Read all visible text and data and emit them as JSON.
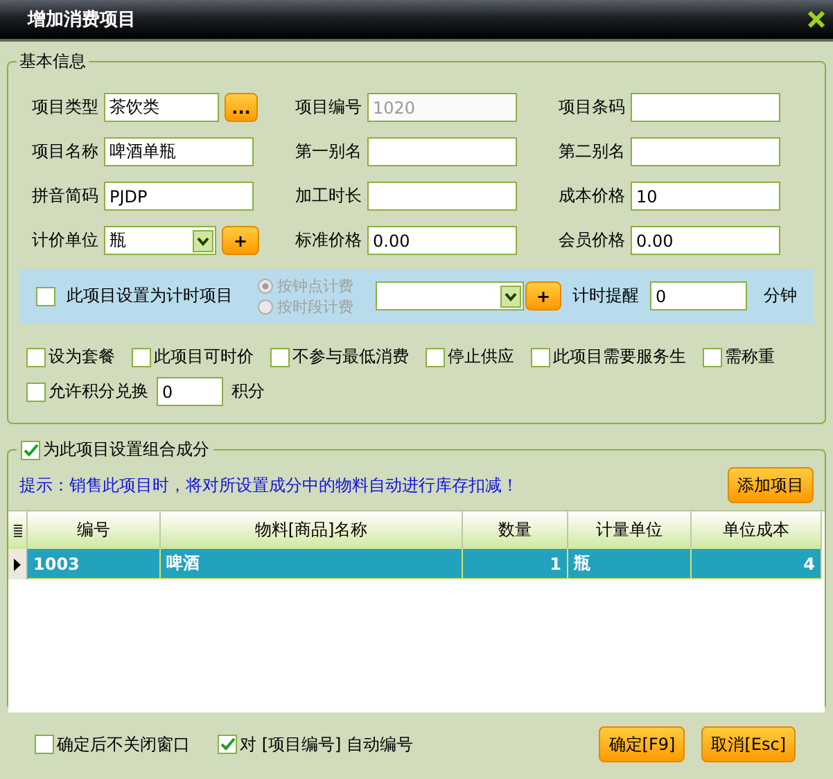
{
  "window": {
    "title": "增加消费项目"
  },
  "basic_info": {
    "title": "基本信息",
    "rows": [
      [
        {
          "label": "项目类型",
          "value": "茶饮类",
          "kind": "browse",
          "button": "...",
          "disabled": false
        },
        {
          "label": "项目编号",
          "value": "1020",
          "kind": "text",
          "disabled": true
        },
        {
          "label": "项目条码",
          "kind": "text"
        }
      ],
      [
        {
          "label": "项目名称",
          "value": "啤酒单瓶",
          "kind": "text",
          "disabled": false
        },
        {
          "label": "第一别名",
          "kind": "text"
        },
        {
          "label": "第二别名",
          "kind": "text"
        }
      ],
      [
        {
          "label": "拼音简码",
          "value": "PJDP",
          "kind": "text",
          "disabled": false
        },
        {
          "label": "加工时长",
          "kind": "text"
        },
        {
          "label": "成本价格",
          "value": "10",
          "kind": "text",
          "disabled": false
        }
      ],
      [
        {
          "label": "计价单位",
          "value": "瓶",
          "kind": "select",
          "button": "+",
          "disabled": false
        },
        {
          "label": "标准价格",
          "value": "0.00",
          "kind": "text",
          "disabled": false
        },
        {
          "label": "会员价格",
          "value": "0.00",
          "kind": "text",
          "disabled": false
        }
      ]
    ],
    "timing": {
      "checked": false,
      "label": "此项目设置为计时项目",
      "options": [
        {
          "label": "按钟点计费",
          "selected": true,
          "disabled": true
        },
        {
          "label": "按时段计费",
          "selected": false,
          "disabled": true
        }
      ],
      "add_button": "+",
      "reminder_label": "计时提醒",
      "reminder_value": "0",
      "unit": "分钟"
    },
    "options": [
      {
        "label": "设为套餐",
        "checked": false
      },
      {
        "label": "此项目可时价",
        "checked": false
      },
      {
        "label": "不参与最低消费",
        "checked": false
      },
      {
        "label": "停止供应",
        "checked": false
      },
      {
        "label": "此项目需要服务生",
        "checked": false
      },
      {
        "label": "需称重",
        "checked": false
      }
    ],
    "points": {
      "label": "允许积分兑换",
      "checked": false,
      "value": "0",
      "unit": "积分"
    }
  },
  "composition": {
    "label": "为此项目设置组合成分",
    "checked": true,
    "hint": "提示：销售此项目时，将对所设置成分中的物料自动进行库存扣减！",
    "add_button": "添加项目",
    "columns": [
      "编号",
      "物料[商品]名称",
      "数量",
      "计量单位",
      "单位成本"
    ],
    "rows": [
      {
        "cells": [
          "1003",
          "啤酒",
          "1",
          "瓶",
          "4"
        ],
        "selected": true
      }
    ]
  },
  "footer": {
    "checkboxes": [
      {
        "label": "确定后不关闭窗口",
        "checked": false
      },
      {
        "label": "对 [项目编号] 自动编号",
        "checked": true
      }
    ],
    "buttons": [
      "确定[F9]",
      "取消[Esc]"
    ]
  }
}
